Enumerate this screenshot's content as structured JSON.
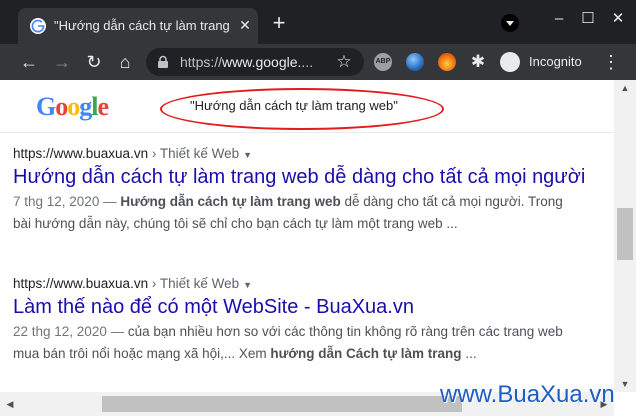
{
  "browser": {
    "tab_title": "\"Hướng dẫn cách tự làm trang we",
    "tab_close": "✕",
    "new_tab": "+",
    "url_prefix": "https://",
    "url_host": "www.google.",
    "url_suffix": "...",
    "incognito_label": "Incognito",
    "ext_abp": "ABP",
    "window_buttons": {
      "minimize": "–",
      "maximize": "☐",
      "close": "✕"
    }
  },
  "search": {
    "query": "\"Hướng dẫn cách tự làm trang web\"",
    "highlight_color": "#e31b1b"
  },
  "results": [
    {
      "site": "https://www.buaxua.vn",
      "crumb": " › Thiết kế Web",
      "title": "Hướng dẫn cách tự làm trang web dễ dàng cho tất cả mọi người",
      "date": "7 thg 12, 2020 — ",
      "line1_bold": "Hướng dẫn cách tự làm trang web",
      "line1_rest": " dễ dàng cho tất cả mọi người. Trong",
      "line2": "bài hướng dẫn này, chúng tôi sẽ chỉ cho bạn cách tự làm một trang web ..."
    },
    {
      "site": "https://www.buaxua.vn",
      "crumb": " › Thiết kế Web",
      "title": "Làm thế nào để có một WebSite - BuaXua.vn",
      "date": "22 thg 12, 2020 — ",
      "line1_rest": "của bạn nhiều hơn so với các thông tin không rõ ràng trên các trang web",
      "line2_pre": "mua bán trôi nổi hoặc mạng xã hội,... Xem ",
      "line2_bold": "hướng dẫn Cách tự làm trang",
      "line2_post": " ..."
    }
  ],
  "watermark": "www.BuaXua.vn",
  "colors": {
    "link": "#1a0dab",
    "accent": "#1e5dc4",
    "chrome_dark": "#202124"
  }
}
